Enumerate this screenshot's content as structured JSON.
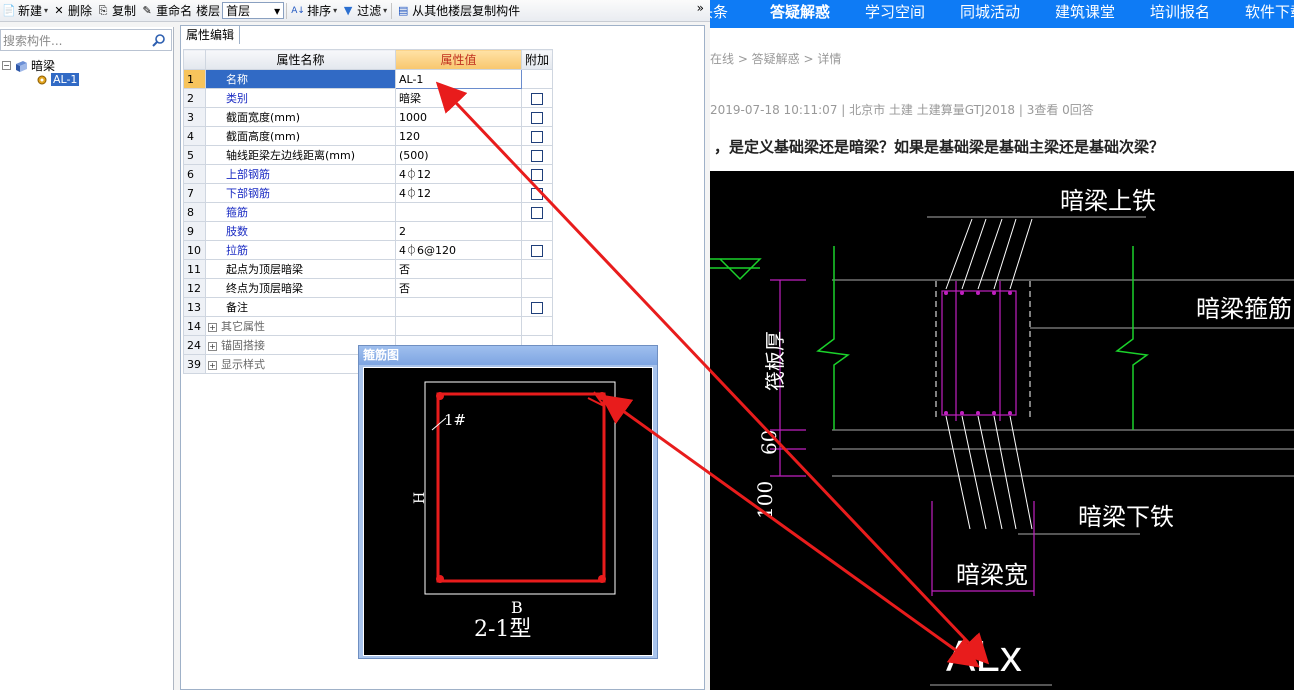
{
  "toolbar": {
    "new": "新建",
    "delete": "删除",
    "copy": "复制",
    "rename": "重命名",
    "floor_label": "楼层",
    "floor_value": "首层",
    "sort": "排序",
    "filter": "过滤",
    "copy_from_floor": "从其他楼层复制构件",
    "more": "»"
  },
  "tree": {
    "search_placeholder": "搜索构件...",
    "root": "暗梁",
    "child": "AL-1"
  },
  "panel": {
    "tab": "属性编辑",
    "headers": {
      "index": "",
      "name": "属性名称",
      "value": "属性值",
      "extra": "附加"
    },
    "rows": [
      {
        "idx": "1",
        "name": "名称",
        "value": "AL-1",
        "check": false,
        "blue": false,
        "selected": true
      },
      {
        "idx": "2",
        "name": "类别",
        "value": "暗梁",
        "check": true,
        "blue": true
      },
      {
        "idx": "3",
        "name": "截面宽度(mm)",
        "value": "1000",
        "check": true,
        "blue": false
      },
      {
        "idx": "4",
        "name": "截面高度(mm)",
        "value": "120",
        "check": true,
        "blue": false
      },
      {
        "idx": "5",
        "name": "轴线距梁左边线距离(mm)",
        "value": "(500)",
        "check": true,
        "blue": false
      },
      {
        "idx": "6",
        "name": "上部钢筋",
        "value": "4⏀12",
        "check": true,
        "blue": true
      },
      {
        "idx": "7",
        "name": "下部钢筋",
        "value": "4⏀12",
        "check": true,
        "blue": true
      },
      {
        "idx": "8",
        "name": "箍筋",
        "value": "",
        "check": true,
        "blue": true
      },
      {
        "idx": "9",
        "name": "肢数",
        "value": "2",
        "check": false,
        "blue": true
      },
      {
        "idx": "10",
        "name": "拉筋",
        "value": "4⏀6@120",
        "check": true,
        "blue": true
      },
      {
        "idx": "11",
        "name": "起点为顶层暗梁",
        "value": "否",
        "check": false,
        "blue": false
      },
      {
        "idx": "12",
        "name": "终点为顶层暗梁",
        "value": "否",
        "check": false,
        "blue": false
      },
      {
        "idx": "13",
        "name": "备注",
        "value": "",
        "check": true,
        "blue": false
      }
    ],
    "groups": [
      {
        "idx": "14",
        "name": "其它属性"
      },
      {
        "idx": "24",
        "name": "锚固搭接"
      },
      {
        "idx": "39",
        "name": "显示样式"
      }
    ]
  },
  "dialog": {
    "title": "箍筋图",
    "label_leg": "1#",
    "label_h": "H",
    "label_b": "B",
    "label_type": "2-1型"
  },
  "web": {
    "nav": [
      "头条",
      "答疑解惑",
      "学习空间",
      "同城活动",
      "建筑课堂",
      "培训报名",
      "软件下载"
    ],
    "nav_active": "答疑解惑",
    "breadcrumb": "在线 > 答疑解惑 > 详情",
    "meta": "2019-07-18 10:11:07    |    北京市  土建 土建算量GTJ2018    |    3查看  0回答",
    "question": "，是定义基础梁还是暗梁？如果是基础梁是基础主梁还是基础次梁？",
    "cad_labels": {
      "top_rebar": "暗梁上铁",
      "stirrup": "暗梁箍筋",
      "slab": "筏板厚",
      "dim60": "60",
      "dim100": "100",
      "bottom_rebar": "暗梁下铁",
      "width": "暗梁宽",
      "code": "ALx"
    }
  },
  "colors": {
    "nav_blue": "#0e7bf5",
    "cad_green": "#1bd12b",
    "cad_magenta": "#c020c0",
    "annotation_red": "#e81c1c",
    "selection_blue": "#316ac5",
    "header_orange": "#f8c66d"
  }
}
